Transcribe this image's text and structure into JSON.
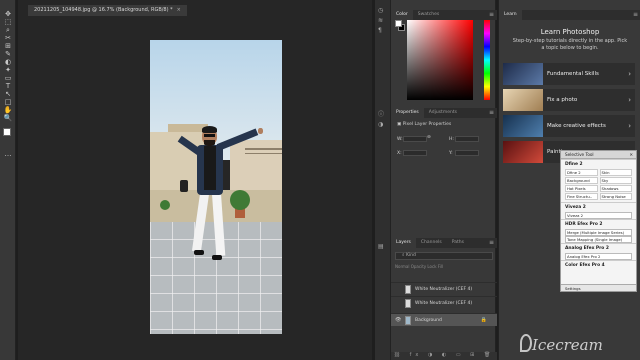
{
  "document": {
    "tab_title": "20211205_104948.jpg @ 16.7% (Background, RGB/8) *",
    "close_glyph": "×"
  },
  "tools": [
    "✥",
    "⬚",
    "⌕",
    "✂",
    "⊞",
    "✎",
    "◐",
    "✦",
    "▭",
    "T",
    "↖",
    "□",
    "✋",
    "🔍",
    "…"
  ],
  "color_panel": {
    "tabs": [
      "Color",
      "Swatches"
    ]
  },
  "properties_panel": {
    "tabs": [
      "Properties",
      "Adjustments"
    ],
    "heading": "Pixel Layer Properties",
    "w_label": "W:",
    "h_label": "H:",
    "x_label": "X:",
    "y_label": "Y:"
  },
  "layers_panel": {
    "tabs": [
      "Layers",
      "Channels",
      "Paths"
    ],
    "search_placeholder": "Kind",
    "options": "Normal  Opacity  Lock  Fill",
    "layers": [
      {
        "name": "White Neutralizer (CEF 4)",
        "visible": false,
        "selected": false
      },
      {
        "name": "White Neutralizer (CEF 4)",
        "visible": false,
        "selected": false
      },
      {
        "name": "Background",
        "visible": true,
        "selected": true
      }
    ],
    "bottom_icons": "⛓ fx ◑ ◐ ▭ ⊞ 🗑"
  },
  "learn_panel": {
    "tab": "Learn",
    "title": "Learn Photoshop",
    "subtitle": "Step-by-step tutorials directly in the app. Pick a topic below to begin.",
    "cards": [
      {
        "label": "Fundamental Skills",
        "color": "#3b4a6b"
      },
      {
        "label": "Fix a photo",
        "color": "#c9b089"
      },
      {
        "label": "Make creative effects",
        "color": "#2a4f79"
      },
      {
        "label": "Painting",
        "color": "#9d2b2b"
      }
    ]
  },
  "selective_tool": {
    "title": "Selective Tool",
    "sections": [
      {
        "title": "Dfine 2",
        "grid": [
          "Dfine 2",
          "Skin",
          "Background",
          "Sky",
          "Hot Pixels",
          "Shadows",
          "Fine Structu..",
          "Strong Noise"
        ]
      },
      {
        "title": "Viveza 2",
        "items": [
          "Viveza 2"
        ]
      },
      {
        "title": "HDR Efex Pro 2",
        "items": [
          "Merge (Multiple Image Series)",
          "Tone Mapping (Single Image)"
        ]
      },
      {
        "title": "Analog Efex Pro 2",
        "items": [
          "Analog Efex Pro 2"
        ]
      },
      {
        "title": "Color Efex Pro 4",
        "items": []
      }
    ],
    "footer": "Settings"
  },
  "watermark": "Icecream"
}
